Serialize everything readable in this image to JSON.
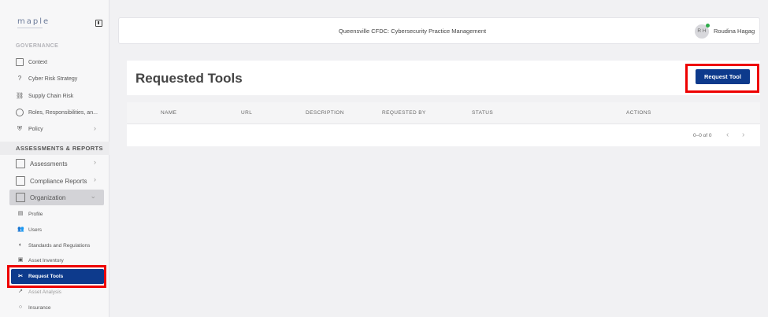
{
  "sidebar": {
    "logo": "maple",
    "sections": {
      "governance": "GOVERNANCE",
      "assessments": "ASSESSMENTS & REPORTS"
    },
    "governance_items": [
      {
        "label": "Context"
      },
      {
        "label": "Cyber Risk Strategy"
      },
      {
        "label": "Supply Chain Risk"
      },
      {
        "label": "Roles, Responsibilities, an..."
      },
      {
        "label": "Policy"
      }
    ],
    "assessment_items": [
      {
        "label": "Assessments"
      },
      {
        "label": "Compliance Reports"
      },
      {
        "label": "Organization"
      }
    ],
    "organization_sub": [
      {
        "label": "Profile"
      },
      {
        "label": "Users"
      },
      {
        "label": "Standards and Regulations"
      },
      {
        "label": "Asset Inventory"
      },
      {
        "label": "Request Tools"
      },
      {
        "label": "Asset Analysis"
      },
      {
        "label": "Insurance"
      }
    ]
  },
  "header": {
    "title": "Queensville CFDC: Cybersecurity Practice Management",
    "avatar_initials": "R H",
    "user_name": "Roudina Hagag"
  },
  "main": {
    "page_title": "Requested Tools",
    "request_button": "Request Tool",
    "table": {
      "columns": [
        "NAME",
        "URL",
        "DESCRIPTION",
        "REQUESTED BY",
        "STATUS",
        "ACTIONS"
      ]
    },
    "pagination": {
      "range": "0–0 of 0"
    }
  },
  "colors": {
    "primary": "#0d3a8c",
    "highlight": "#e00000",
    "online": "#2eab4a"
  }
}
